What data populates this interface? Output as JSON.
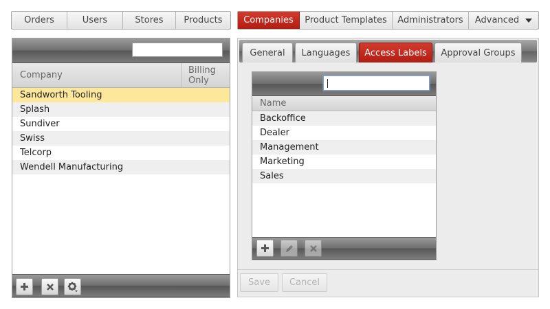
{
  "left_tabs": [
    {
      "label": "Orders"
    },
    {
      "label": "Users"
    },
    {
      "label": "Stores"
    },
    {
      "label": "Products"
    }
  ],
  "right_tabs": [
    {
      "label": "Companies",
      "active": true
    },
    {
      "label": "Product Templates"
    },
    {
      "label": "Administrators"
    },
    {
      "label": "Advanced"
    }
  ],
  "company_panel": {
    "search_value": "",
    "columns": {
      "company": "Company",
      "billing_only": "Billing Only"
    },
    "rows": [
      {
        "company": "Sandworth Tooling",
        "selected": true
      },
      {
        "company": "Splash"
      },
      {
        "company": "Sundiver"
      },
      {
        "company": "Swiss"
      },
      {
        "company": "Telcorp"
      },
      {
        "company": "Wendell Manufacturing"
      }
    ],
    "footer_icons": [
      "plus-icon",
      "close-icon",
      "gear-icon"
    ]
  },
  "sub_tabs": [
    {
      "label": "General"
    },
    {
      "label": "Languages"
    },
    {
      "label": "Access Labels",
      "active": true
    },
    {
      "label": "Approval Groups"
    }
  ],
  "labels_panel": {
    "search_value": "",
    "column_name": "Name",
    "rows": [
      {
        "name": "Backoffice"
      },
      {
        "name": "Dealer"
      },
      {
        "name": "Management"
      },
      {
        "name": "Marketing"
      },
      {
        "name": "Sales"
      }
    ],
    "footer_icons": [
      "plus-icon",
      "pencil-icon",
      "close-icon"
    ]
  },
  "form_buttons": {
    "save": "Save",
    "cancel": "Cancel"
  },
  "colors": {
    "accent_red": "#c0281c",
    "selected_row": "#fde79a"
  }
}
